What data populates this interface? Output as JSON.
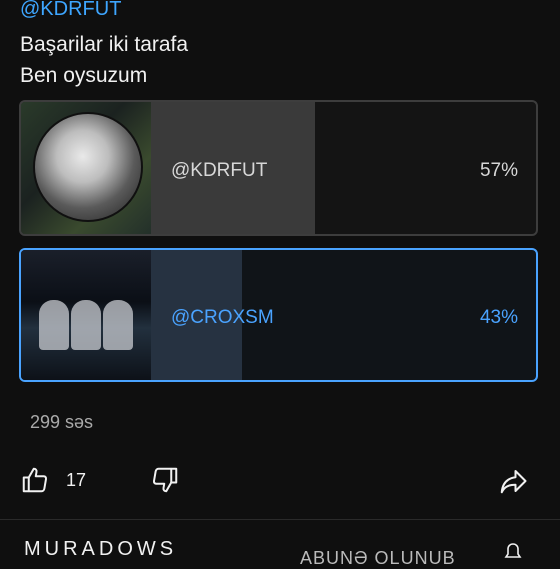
{
  "post": {
    "handle": "@KDRFUT",
    "text_line1": "Başarilar iki tarafa",
    "text_line2": "Ben oysuzum"
  },
  "poll": {
    "options": [
      {
        "label": "@KDRFUT",
        "percent": "57%",
        "fraction": 0.57,
        "selected": false
      },
      {
        "label": "@CROXSM",
        "percent": "43%",
        "fraction": 0.43,
        "selected": true
      }
    ],
    "votes_text": "299 səs"
  },
  "actions": {
    "like_count": "17",
    "icons": [
      "thumbs-up-icon",
      "thumbs-down-icon",
      "share-icon",
      "bell-icon"
    ]
  },
  "footer": {
    "channel_name": "MURADOWS",
    "subscribe_label": "ABUNƏ OLUNUB"
  },
  "colors": {
    "accent": "#3ea6ff",
    "background": "#0f0f0f",
    "selected_fill": "#263241",
    "unselected_fill": "#3a3a3a"
  }
}
